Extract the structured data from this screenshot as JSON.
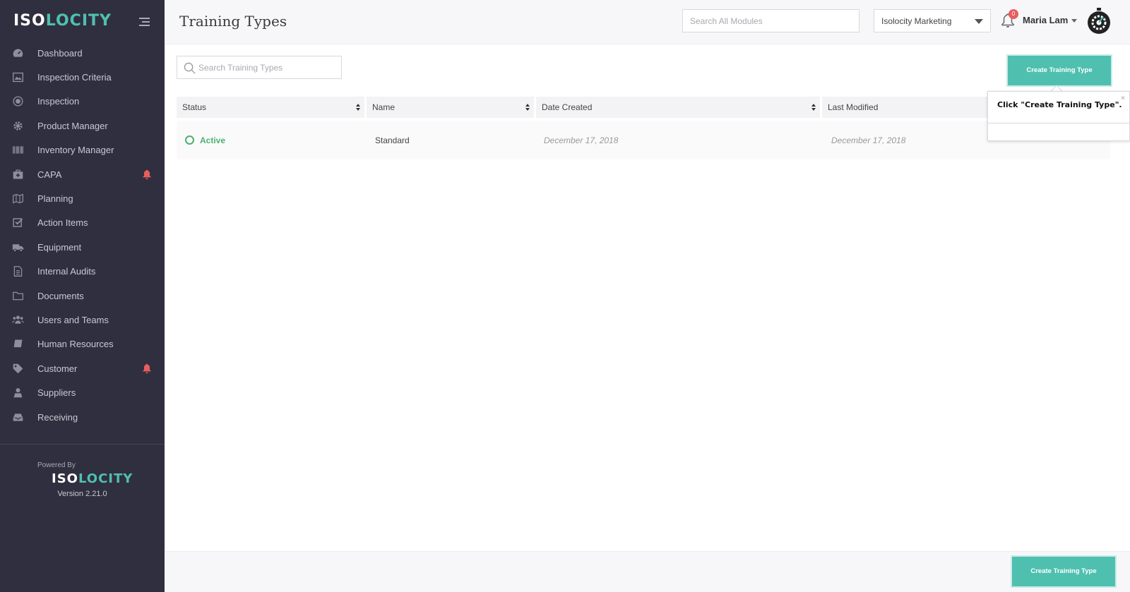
{
  "brand": {
    "logo_iso": "ISO",
    "logo_locity": "LOCITY",
    "accent": "#4fc0b0"
  },
  "sidebar": {
    "items": [
      {
        "label": "Dashboard",
        "icon": "dashboard-icon"
      },
      {
        "label": "Inspection Criteria",
        "icon": "chart-image-icon"
      },
      {
        "label": "Inspection",
        "icon": "target-icon"
      },
      {
        "label": "Product Manager",
        "icon": "gear-icon"
      },
      {
        "label": "Inventory Manager",
        "icon": "barcode-icon"
      },
      {
        "label": "CAPA",
        "icon": "medkit-icon",
        "alert": true
      },
      {
        "label": "Planning",
        "icon": "map-icon"
      },
      {
        "label": "Action Items",
        "icon": "checkbox-icon"
      },
      {
        "label": "Equipment",
        "icon": "truck-icon"
      },
      {
        "label": "Internal Audits",
        "icon": "document-icon"
      },
      {
        "label": "Documents",
        "icon": "folder-icon"
      },
      {
        "label": "Users and Teams",
        "icon": "users-icon"
      },
      {
        "label": "Human Resources",
        "icon": "book-icon"
      },
      {
        "label": "Customer",
        "icon": "tag-icon",
        "alert": true
      },
      {
        "label": "Suppliers",
        "icon": "supplier-icon"
      },
      {
        "label": "Receiving",
        "icon": "inbox-icon"
      }
    ],
    "powered_by": "Powered By",
    "version": "Version 2.21.0"
  },
  "header": {
    "title": "Training Types",
    "search_placeholder": "Search All Modules",
    "company": "Isolocity Marketing",
    "notification_count": "0",
    "user_name": "Maria Lam"
  },
  "table": {
    "search_placeholder": "Search Training Types",
    "create_label": "Create Training Type",
    "columns": [
      "Status",
      "Name",
      "Date Created",
      "Last Modified"
    ],
    "rows": [
      {
        "status": "Active",
        "name": "Standard",
        "date_created": "December 17, 2018",
        "last_modified": "December 17, 2018"
      }
    ]
  },
  "tooltip": {
    "text": "Click \"Create Training Type\".",
    "close": "×"
  },
  "footer": {
    "create_label": "Create Training Type"
  }
}
